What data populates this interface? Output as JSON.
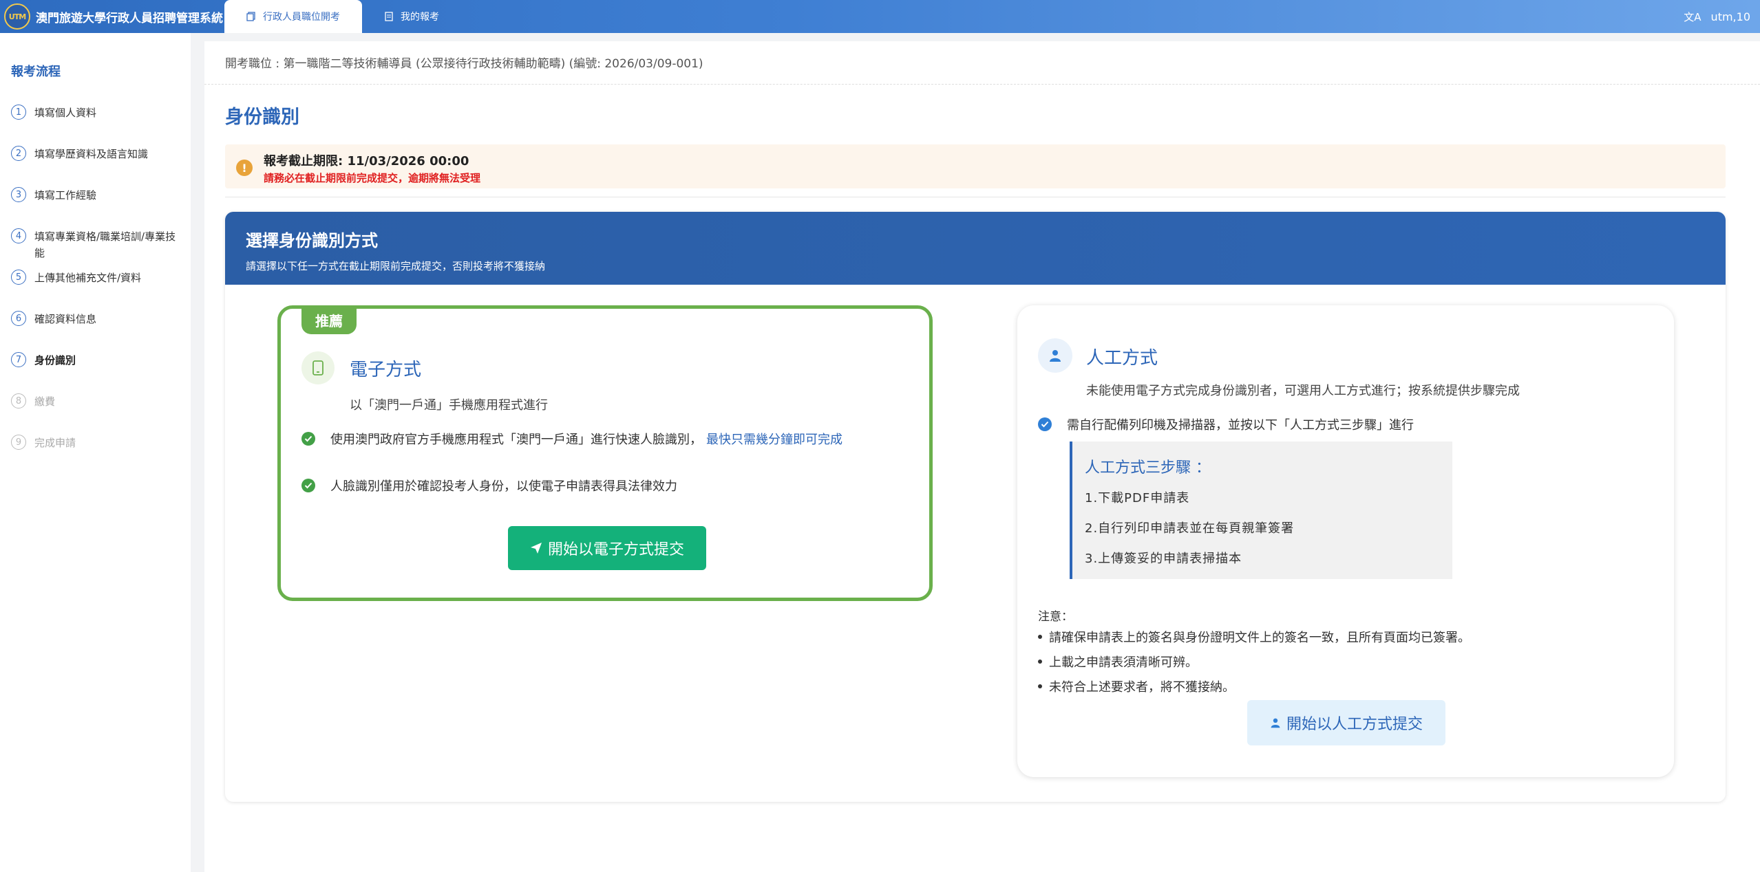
{
  "app": {
    "logo_text": "UTM",
    "title": "澳門旅遊大學行政人員招聘管理系統"
  },
  "tabs": [
    {
      "label": "行政人員職位開考"
    },
    {
      "label": "我的報考"
    }
  ],
  "user": {
    "name": "utm,10"
  },
  "sidebar": {
    "title": "報考流程",
    "steps": [
      {
        "num": "1",
        "label": "填寫個人資料"
      },
      {
        "num": "2",
        "label": "填寫學歷資料及語言知識"
      },
      {
        "num": "3",
        "label": "填寫工作經驗"
      },
      {
        "num": "4",
        "label": "填寫專業資格/職業培訓/專業技能"
      },
      {
        "num": "5",
        "label": "上傳其他補充文件/資料"
      },
      {
        "num": "6",
        "label": "確認資料信息"
      },
      {
        "num": "7",
        "label": "身份識別"
      },
      {
        "num": "8",
        "label": "繳費"
      },
      {
        "num": "9",
        "label": "完成申請"
      }
    ]
  },
  "main": {
    "position_line": "開考職位 : 第一職階二等技術輔導員 (公眾接待行政技術輔助範疇) (編號: 2026/03/09-001)",
    "page_title": "身份識別",
    "deadline": {
      "title": "報考截止期限: 11/03/2026 00:00",
      "warning": "請務必在截止期限前完成提交，逾期將無法受理"
    },
    "panel": {
      "title": "選擇身份識別方式",
      "subtitle": "請選擇以下任一方式在截止期限前完成提交，否則投考將不獲接納"
    },
    "electronic": {
      "badge": "推薦",
      "title": "電子方式",
      "subtitle": "以「澳門一戶通」手機應用程式進行",
      "item1": "使用澳門政府官方手機應用程式「澳門一戶通」進行快速人臉識別，",
      "item1_link": "最快只需幾分鐘即可完成",
      "item2": "人臉識別僅用於確認投考人身份，以使電子申請表得具法律效力",
      "button": "開始以電子方式提交"
    },
    "manual": {
      "title": "人工方式",
      "subtitle": "未能使用電子方式完成身份識別者，可選用人工方式進行；按系統提供步驟完成",
      "item1": "需自行配備列印機及掃描器，並按以下「人工方式三步驟」進行",
      "steps_title": "人工方式三步驟 ：",
      "steps": [
        "1.下載PDF申請表",
        "2.自行列印申請表並在每頁親筆簽署",
        "3.上傳簽妥的申請表掃描本"
      ],
      "notes_title": "注意：",
      "notes": [
        "請確保申請表上的簽名與身份證明文件上的簽名一致，且所有頁面均已簽署。",
        "上載之申請表須清晰可辨。",
        "未符合上述要求者，將不獲接納。"
      ],
      "button": "開始以人工方式提交"
    }
  },
  "colors": {
    "primary": "#2d66b8",
    "recommended_green": "#6ab04c",
    "submit_green": "#14b17a",
    "warning_red": "#e02020"
  }
}
